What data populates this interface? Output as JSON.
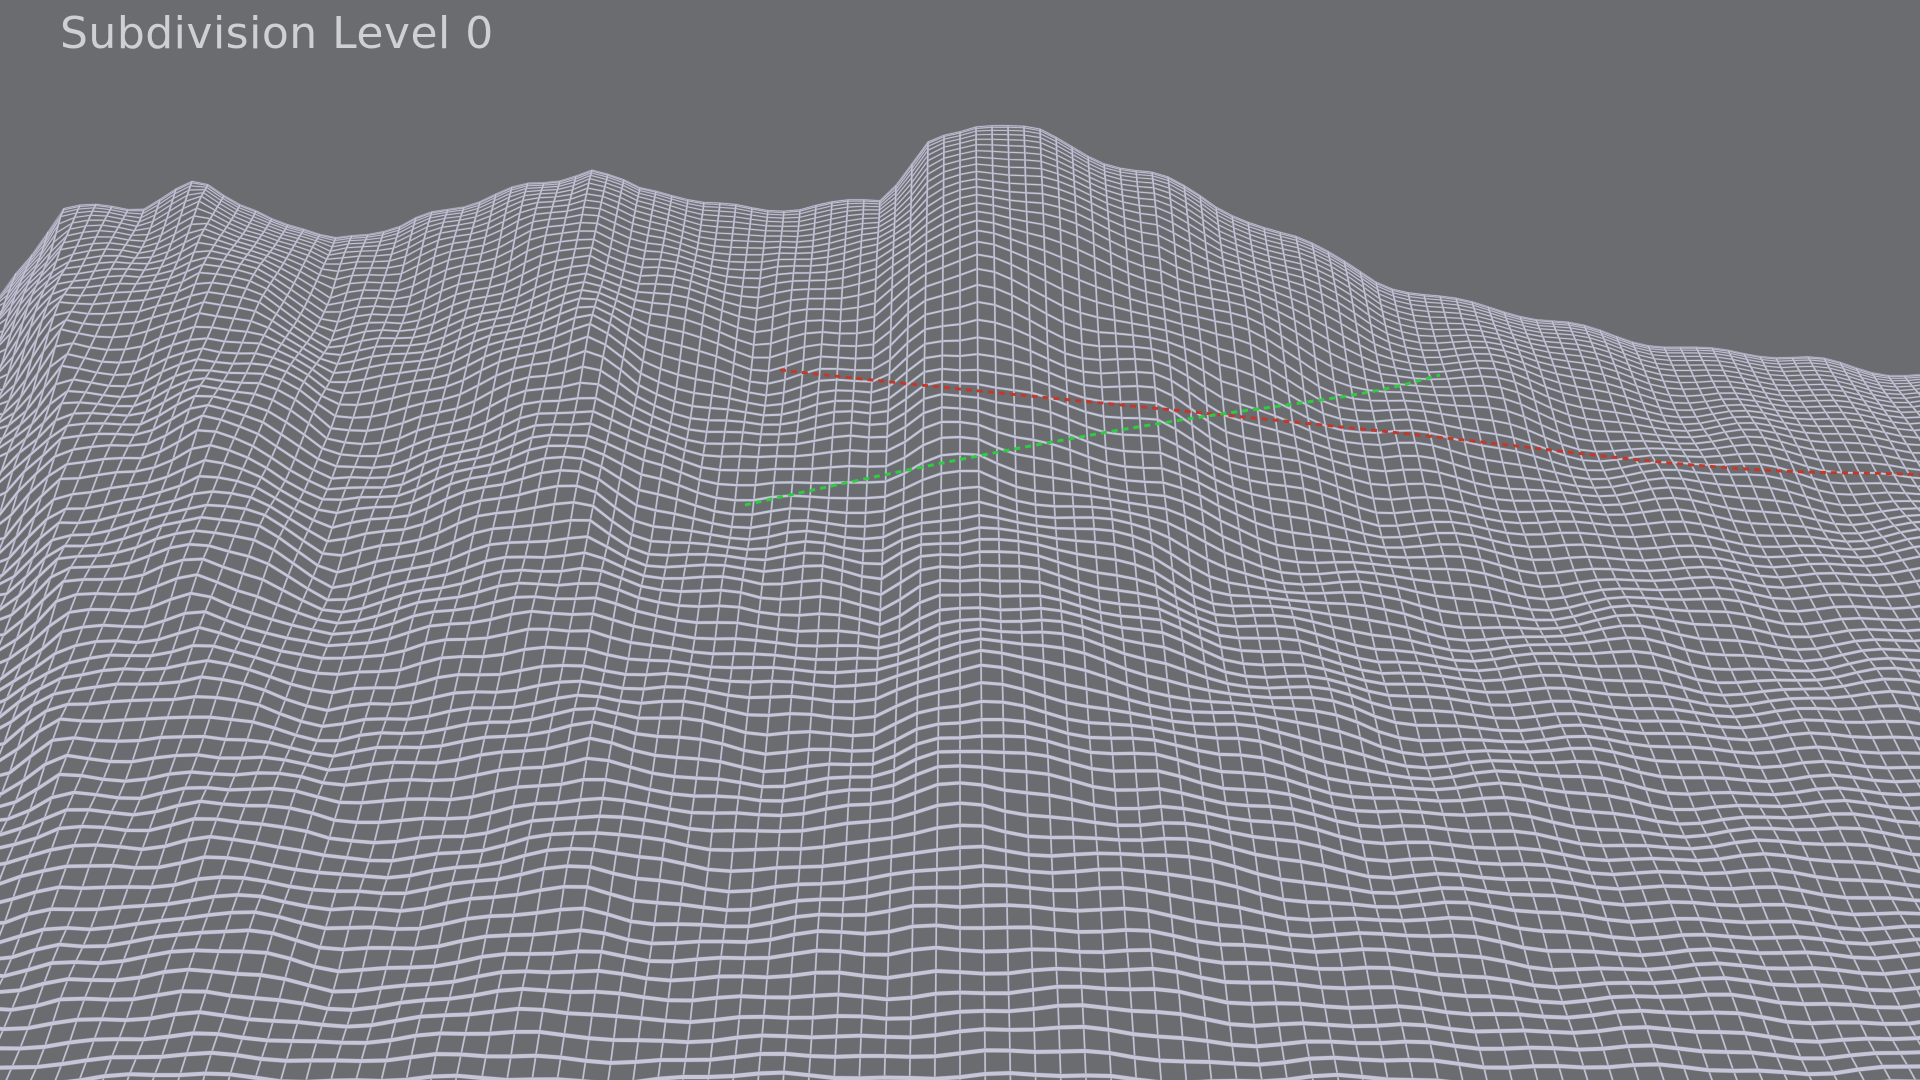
{
  "viewport": {
    "overlay_label": "Subdivision Level 0",
    "background_color": "#6b6c6f",
    "wire_color": "#c8c9dc",
    "wire_shadow_color": "#8a8b98",
    "axis_x_color": "#c0392b",
    "axis_y_color": "#2ecc40"
  }
}
